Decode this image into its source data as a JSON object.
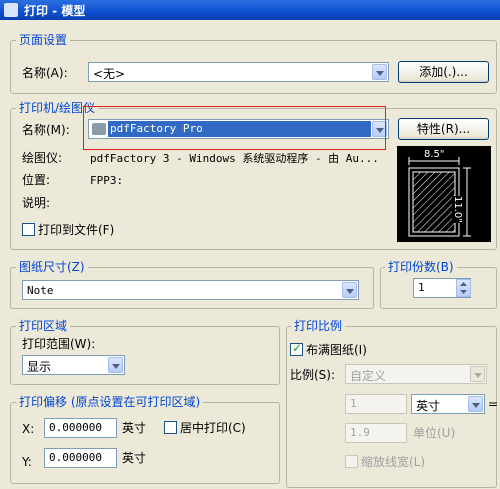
{
  "window": {
    "title": "打印 - 模型"
  },
  "page_setup": {
    "group_label": "页面设置",
    "name_label": "名称(A):",
    "name_value": "<无>",
    "add_button": "添加(.)..."
  },
  "printer": {
    "group_label": "打印机/绘图仪",
    "name_label": "名称(M):",
    "name_value": "pdfFactory Pro",
    "properties_button": "特性(R)...",
    "plotter_label": "绘图仪:",
    "plotter_value": "pdfFactory 3 - Windows 系统驱动程序 - 由 Au...",
    "location_label": "位置:",
    "location_value": "FPP3:",
    "description_label": "说明:",
    "print_to_file_label": "打印到文件(F)",
    "preview_width": "8.5\"",
    "preview_height": "11.0\""
  },
  "paper_size": {
    "group_label": "图纸尺寸(Z)",
    "value": "Note"
  },
  "copies": {
    "group_label": "打印份数(B)",
    "value": "1"
  },
  "plot_area": {
    "group_label": "打印区域",
    "range_label": "打印范围(W):",
    "range_value": "显示"
  },
  "plot_offset": {
    "group_label": "打印偏移 (原点设置在可打印区域)",
    "x_label": "X:",
    "x_value": "0.000000",
    "x_unit": "英寸",
    "y_label": "Y:",
    "y_value": "0.000000",
    "y_unit": "英寸",
    "center_label": "居中打印(C)"
  },
  "plot_scale": {
    "group_label": "打印比例",
    "fit_label": "布满图纸(I)",
    "fit_checked": true,
    "scale_label": "比例(S):",
    "scale_value": "自定义",
    "val1": "1",
    "unit1": "英寸",
    "equals": "=",
    "val2": "1.9",
    "unit2": "单位(U)",
    "lineweight_label": "缩放线宽(L)"
  }
}
